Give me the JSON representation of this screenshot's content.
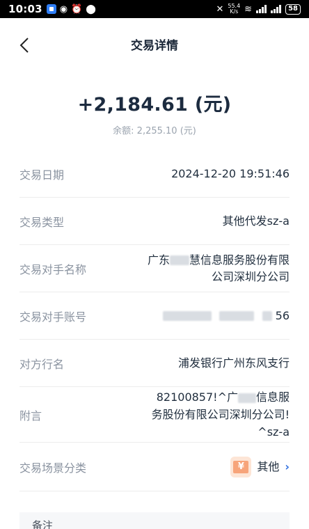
{
  "status_bar": {
    "time": "10:03",
    "net_speed_value": "55.4",
    "net_speed_unit": "K/s",
    "battery": "58"
  },
  "nav": {
    "title": "交易详情"
  },
  "amount": {
    "value": "+2,184.61 (元)",
    "balance": "余额: 2,255.10 (元)"
  },
  "details": {
    "date_label": "交易日期",
    "date_value": "2024-12-20 19:51:46",
    "type_label": "交易类型",
    "type_value": "其他代发sz-a",
    "name_label": "交易对手名称",
    "name_line1_a": "广东",
    "name_line1_b": "慧信息服务股份有限",
    "name_line2": "公司深圳分公司",
    "account_label": "交易对手账号",
    "account_suffix": "56",
    "bank_label": "对方行名",
    "bank_value": "浦发银行广州东风支行",
    "memo_label": "附言",
    "memo_line1_a": "82100857!^广",
    "memo_line1_b": "信息服",
    "memo_line2": "务股份有限公司深圳分公司!",
    "memo_line3": "^sz-a",
    "scene_label": "交易场景分类",
    "scene_value": "其他",
    "scene_icon_glyph": "¥"
  },
  "remark": {
    "label": "备注"
  }
}
